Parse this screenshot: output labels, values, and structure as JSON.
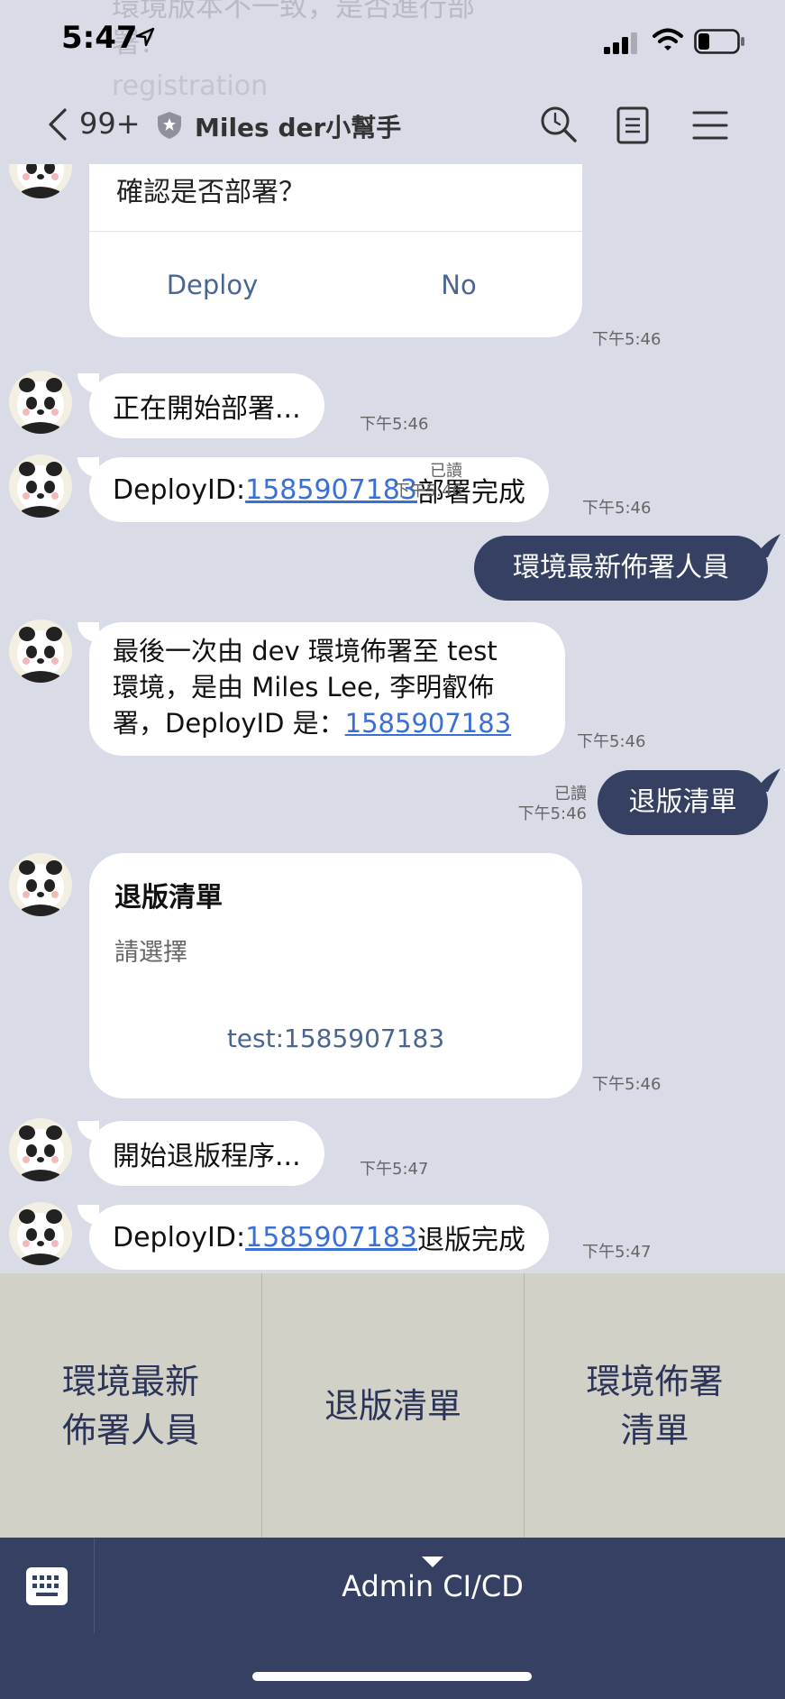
{
  "status_bar": {
    "time": "5:47"
  },
  "ghost_preview": {
    "text": "環境版本不一致，是否進行部署？",
    "sub": "registration"
  },
  "header": {
    "unread_count": "99+",
    "title": "Miles der小幫手"
  },
  "messages": {
    "confirm_card": {
      "question": "確認是否部署？",
      "actions": [
        "Deploy",
        "No"
      ],
      "time": "下午5:46"
    },
    "m1": {
      "text": "正在開始部署...",
      "time": "下午5:46"
    },
    "m2": {
      "prefix": "DeployID:",
      "link": "1585907183",
      "suffix": "部署完成",
      "time": "下午5:46"
    },
    "m3": {
      "text": "環境最新佈署人員",
      "read": "已讀",
      "time": "下午5:46"
    },
    "m4": {
      "line1": "最後一次由 dev 環境佈署至 test",
      "line2": "環境，是由 Miles Lee, 李明叡佈",
      "line3_prefix": "署，DeployID 是：",
      "link": "1585907183",
      "time": "下午5:46"
    },
    "m5": {
      "text": "退版清單",
      "read": "已讀",
      "time": "下午5:46"
    },
    "rollback_card": {
      "title": "退版清單",
      "subtitle": "請選擇",
      "option": "test:1585907183",
      "time": "下午5:46"
    },
    "m6": {
      "text": "開始退版程序...",
      "time": "下午5:47"
    },
    "m7": {
      "prefix": "DeployID:",
      "link": "1585907183",
      "suffix": "退版完成",
      "time": "下午5:47"
    }
  },
  "rich_menu": {
    "items": [
      "環境最新\n佈署人員",
      "退版清單",
      "環境佈署\n清單"
    ]
  },
  "bottom_bar": {
    "menu_label": "Admin CI/CD"
  },
  "colors": {
    "background": "#d9dbe6",
    "my_bubble": "#354063",
    "link": "#3b6fd8",
    "rich_menu": "#d1d1c8",
    "rich_menu_text": "#2c3458"
  }
}
